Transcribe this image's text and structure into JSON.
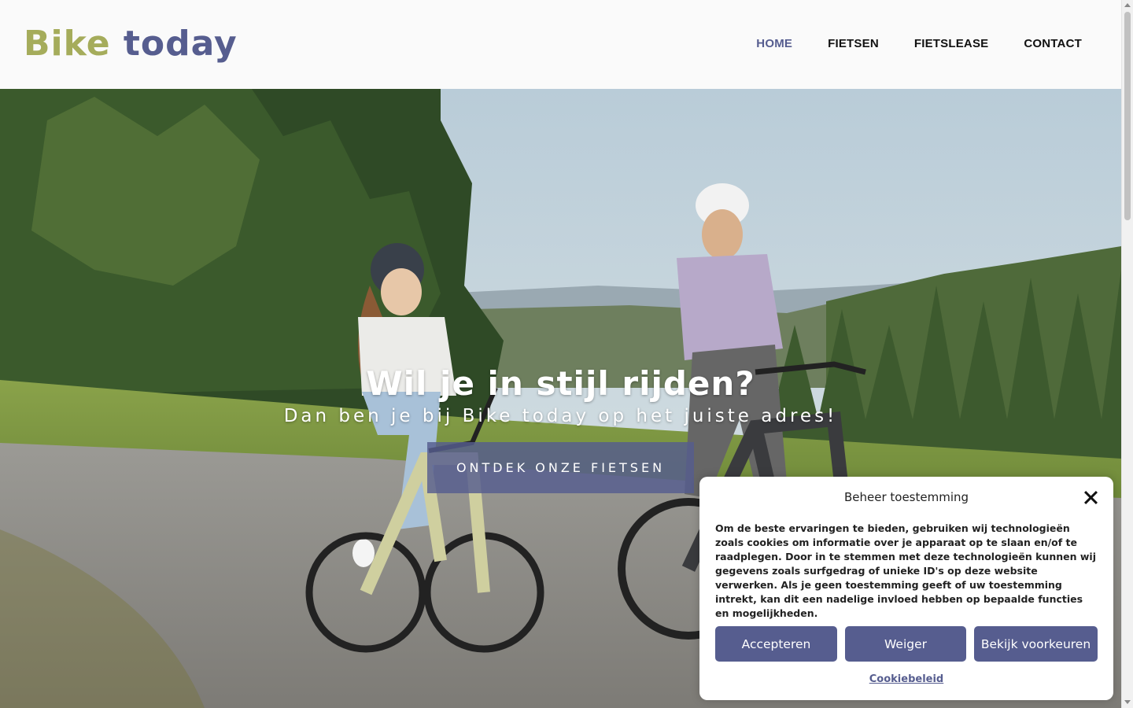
{
  "logo": {
    "word1": "Bike",
    "word2": "today"
  },
  "nav": [
    {
      "label": "HOME",
      "active": true
    },
    {
      "label": "FIETSEN",
      "active": false
    },
    {
      "label": "FIETSLEASE",
      "active": false
    },
    {
      "label": "CONTACT",
      "active": false
    }
  ],
  "hero": {
    "title": "Wil je in stijl rijden?",
    "subtitle": "Dan ben je bij Bike today op het juiste adres!",
    "button": "ONTDEK ONZE FIETSEN"
  },
  "cookie": {
    "title": "Beheer toestemming",
    "text": "Om de beste ervaringen te bieden, gebruiken wij technologieën zoals cookies om informatie over je apparaat op te slaan en/of te raadplegen. Door in te stemmen met deze technologieën kunnen wij gegevens zoals surfgedrag of unieke ID's op deze website verwerken. Als je geen toestemming geeft of uw toestemming intrekt, kan dit een nadelige invloed hebben op bepaalde functies en mogelijkheden.",
    "accept": "Accepteren",
    "deny": "Weiger",
    "preferences": "Bekijk voorkeuren",
    "policy_link": "Cookiebeleid"
  },
  "colors": {
    "brand_green": "#a5ac5b",
    "brand_blue": "#565d8f"
  }
}
